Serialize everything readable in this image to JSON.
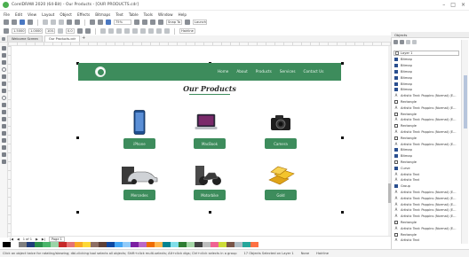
{
  "window": {
    "title": "CorelDRAW 2020 (64-Bit) - Our Products - [OUR PRODUCTS.cdr]"
  },
  "menu": [
    "File",
    "Edit",
    "View",
    "Layout",
    "Object",
    "Effects",
    "Bitmaps",
    "Text",
    "Table",
    "Tools",
    "Window",
    "Help"
  ],
  "toolbar": {
    "zoom": "75%",
    "snap_to": "Snap To",
    "launch": "Launch",
    "width": "1.0000\"",
    "height": "0.6667\"",
    "x": "1.5000\"",
    "y": "2.0000\"",
    "scale_x": "100.0",
    "scale_y": "100.0",
    "angle": "0.0",
    "outline": "Hairline"
  },
  "tabs": [
    "Welcome Screen",
    "Our Products.cdr"
  ],
  "site": {
    "nav_links": [
      "Home",
      "About",
      "Products",
      "Services",
      "Contact Us"
    ],
    "title": "Our Products",
    "products": [
      {
        "name": "iPhone",
        "icon": "phone"
      },
      {
        "name": "MacBook",
        "icon": "laptop"
      },
      {
        "name": "Camera",
        "icon": "camera"
      },
      {
        "name": "Mercedes",
        "icon": "car"
      },
      {
        "name": "Motorbike",
        "icon": "bike"
      },
      {
        "name": "Gold",
        "icon": "gold"
      }
    ]
  },
  "page_nav": {
    "counter": "1 of 1",
    "page_label": "Page 1"
  },
  "palette": [
    "#000000",
    "#ffffff",
    "#7f7f7f",
    "#1f3d7a",
    "#2a8f4b",
    "#4ab56a",
    "#9bd3a7",
    "#c62828",
    "#e57373",
    "#f9a825",
    "#fdd835",
    "#8d6e63",
    "#5d4037",
    "#0d47a1",
    "#42a5f5",
    "#90caf9",
    "#7b1fa2",
    "#ba68c8",
    "#ef6c00",
    "#ffb74d",
    "#00838f",
    "#80deea",
    "#2e7d32",
    "#a5d6a7",
    "#424242",
    "#bdbdbd",
    "#f06292",
    "#cddc39",
    "#795548",
    "#b0bec5",
    "#26a69a",
    "#ff7043"
  ],
  "status": {
    "hint": "Click an object twice for rotating/skewing; dbl-clicking tool selects all objects; Shift+click multi-selects; Alt+click digs; Ctrl+click selects in a group",
    "selection": "17 Objects Selected on Layer 1",
    "fill": "None",
    "outline": "Hairline"
  },
  "docker": {
    "tab": "Objects",
    "layer_select": "Layer 1",
    "items": [
      {
        "type": "obj",
        "label": "Bitmap"
      },
      {
        "type": "obj",
        "label": "Bitmap"
      },
      {
        "type": "obj",
        "label": "Bitmap"
      },
      {
        "type": "obj",
        "label": "Bitmap"
      },
      {
        "type": "obj",
        "label": "Bitmap"
      },
      {
        "type": "obj",
        "label": "Bitmap"
      },
      {
        "type": "text",
        "label": "Artistic Text: Poppins (Normal) (E..."
      },
      {
        "type": "rect",
        "label": "Rectangle"
      },
      {
        "type": "text",
        "label": "Artistic Text: Poppins (Normal) (E..."
      },
      {
        "type": "rect",
        "label": "Rectangle"
      },
      {
        "type": "text",
        "label": "Artistic Text: Poppins (Normal) (E..."
      },
      {
        "type": "rect",
        "label": "Rectangle"
      },
      {
        "type": "text",
        "label": "Artistic Text: Poppins (Normal) (E..."
      },
      {
        "type": "rect",
        "label": "Rectangle"
      },
      {
        "type": "text",
        "label": "Artistic Text: Poppins (Normal) (E..."
      },
      {
        "type": "obj",
        "label": "Bitmap"
      },
      {
        "type": "obj",
        "label": "Bitmap"
      },
      {
        "type": "rect",
        "label": "Rectangle"
      },
      {
        "type": "line",
        "label": "Curve"
      },
      {
        "type": "text",
        "label": "Artistic Text"
      },
      {
        "type": "text",
        "label": "Artistic Text"
      },
      {
        "type": "obj",
        "label": "Group"
      },
      {
        "type": "text",
        "label": "Artistic Text: Poppins (Normal) (E..."
      },
      {
        "type": "text",
        "label": "Artistic Text: Poppins (Normal) (E..."
      },
      {
        "type": "text",
        "label": "Artistic Text: Poppins (Normal) (E..."
      },
      {
        "type": "text",
        "label": "Artistic Text: Poppins (Normal) (E..."
      },
      {
        "type": "text",
        "label": "Artistic Text: Poppins (Normal) (E..."
      },
      {
        "type": "rect",
        "label": "Rectangle"
      },
      {
        "type": "text",
        "label": "Artistic Text: Poppins (Normal) (E..."
      },
      {
        "type": "rect",
        "label": "Rectangle"
      },
      {
        "type": "text",
        "label": "Artistic Text"
      }
    ]
  }
}
